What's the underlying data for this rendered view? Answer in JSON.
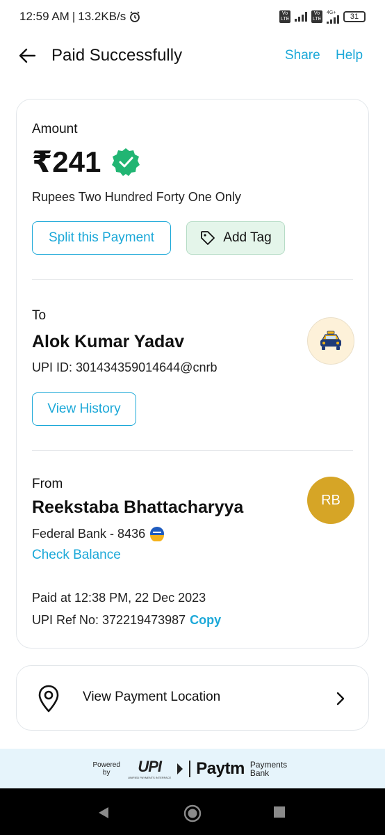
{
  "status_bar": {
    "time": "12:59 AM",
    "speed": "13.2KB/s",
    "volte1": "Vo LTE",
    "volte2": "Vo LTE",
    "net_type": "4G+",
    "battery": "31"
  },
  "header": {
    "title": "Paid Successfully",
    "share": "Share",
    "help": "Help"
  },
  "payment": {
    "amount_label": "Amount",
    "amount": "₹241",
    "amount_words": "Rupees Two Hundred Forty One Only",
    "split_button": "Split this Payment",
    "tag_button": "Add Tag"
  },
  "to": {
    "label": "To",
    "name": "Alok Kumar Yadav",
    "upi_id": "UPI ID: 301434359014644@cnrb",
    "history_button": "View History"
  },
  "from": {
    "label": "From",
    "name": "Reekstaba Bhattacharyya",
    "bank": "Federal Bank - 8436",
    "avatar_initials": "RB",
    "check_balance": "Check Balance"
  },
  "details": {
    "paid_at": "Paid at 12:38 PM, 22 Dec 2023",
    "ref_label": "UPI Ref No: 372219473987",
    "copy": "Copy"
  },
  "location": {
    "label": "View Payment Location"
  },
  "footer": {
    "powered_by": "Powered by",
    "upi": "UPI",
    "upi_sub": "UNIFIED PAYMENTS INTERFACE",
    "paytm": "Paytm",
    "paytm_bank": "Payments Bank"
  },
  "colors": {
    "accent": "#1ba8d8",
    "verified": "#21b573",
    "tag_bg": "#e4f5ea",
    "avatar_rb": "#d6a526"
  }
}
